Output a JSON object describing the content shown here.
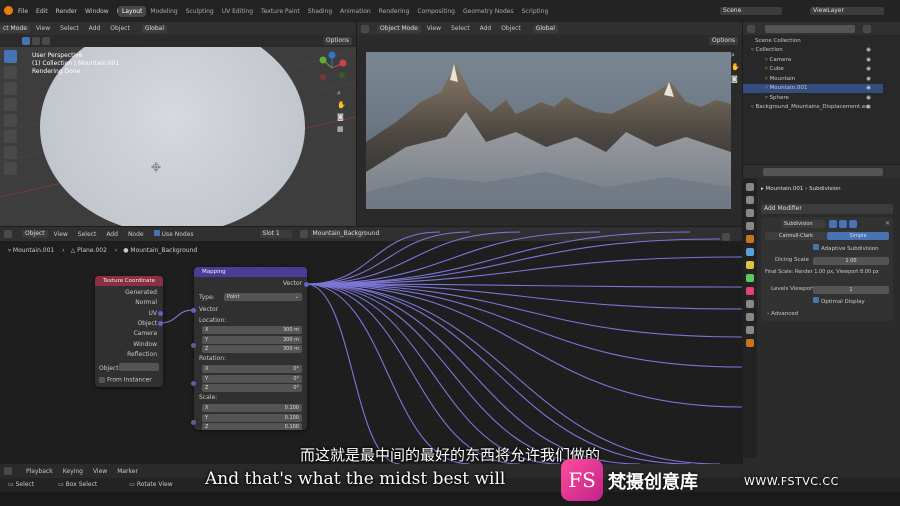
{
  "app": {
    "menus": [
      "File",
      "Edit",
      "Render",
      "Window",
      "Help"
    ],
    "workspaces": [
      "Layout",
      "Modeling",
      "Sculpting",
      "UV Editing",
      "Texture Paint",
      "Shading",
      "Animation",
      "Rendering",
      "Compositing",
      "Geometry Nodes",
      "Scripting"
    ],
    "active_workspace": "Layout",
    "scene": "Scene",
    "view_layer": "ViewLayer"
  },
  "viewport_left": {
    "mode": "ct Mode",
    "menus": [
      "View",
      "Select",
      "Add",
      "Object"
    ],
    "orientation": "Global",
    "options": "Options",
    "overlay_lines": [
      "User Perspective",
      "(1) Collection | Mountain.001",
      "Rendering Done"
    ]
  },
  "viewport_right": {
    "mode": "Object Mode",
    "menus": [
      "View",
      "Select",
      "Add",
      "Object"
    ],
    "orientation": "Global",
    "options": "Options"
  },
  "outliner": {
    "title": "Scene Collection",
    "items": [
      {
        "label": "Collection",
        "indent": 0
      },
      {
        "label": "Camera",
        "indent": 1
      },
      {
        "label": "Cube",
        "indent": 1
      },
      {
        "label": "Mountain",
        "indent": 1
      },
      {
        "label": "Mountain.001",
        "indent": 1,
        "selected": true
      },
      {
        "label": "Sphere",
        "indent": 1
      },
      {
        "label": "Background_Mountains_Displacement.ex",
        "indent": 0
      }
    ]
  },
  "properties": {
    "object": "Mountain.001",
    "modifier_tab": "Subdivision",
    "add_modifier": "Add Modifier",
    "modifier_name": "Subdivision",
    "catmull": "Catmull-Clark",
    "simple": "Simple",
    "adaptive": "Adaptive Subdivision",
    "dicing_label": "Dicing Scale",
    "dicing_value": "1.00",
    "final_scale": "Final Scale: Render 1.00 px, Viewport 8.00 px",
    "levels_label": "Levels Viewport",
    "levels_value": "1",
    "optimal": "Optimal Display",
    "advanced": "Advanced"
  },
  "node_editor": {
    "type": "Object",
    "menus": [
      "View",
      "Select",
      "Add",
      "Node"
    ],
    "use_nodes": "Use Nodes",
    "slot": "Slot 1",
    "material": "Mountain_Background",
    "breadcrumb": [
      "Mountain.001",
      "Plane.002",
      "Mountain_Background"
    ]
  },
  "tex_coord": {
    "title": "Texture Coordinate",
    "outputs": [
      "Generated",
      "Normal",
      "UV",
      "Object",
      "Camera",
      "Window",
      "Reflection"
    ],
    "object_label": "Object:",
    "from_instancer": "From Instancer"
  },
  "mapping": {
    "title": "Mapping",
    "out": "Vector",
    "type_label": "Type:",
    "type_value": "Point",
    "vector": "Vector",
    "location": "Location:",
    "loc": [
      [
        "X",
        "300 m"
      ],
      [
        "Y",
        "300 m"
      ],
      [
        "Z",
        "300 m"
      ]
    ],
    "rotation": "Rotation:",
    "rot": [
      [
        "X",
        "0°"
      ],
      [
        "Y",
        "0°"
      ],
      [
        "Z",
        "0°"
      ]
    ],
    "scale": "Scale:",
    "scl": [
      [
        "X",
        "0.100"
      ],
      [
        "Y",
        "0.100"
      ],
      [
        "Z",
        "0.100"
      ]
    ]
  },
  "timeline": {
    "menus": [
      "Playback",
      "Keying",
      "View",
      "Marker"
    ]
  },
  "status": {
    "items": [
      "Select",
      "Box Select",
      "Rotate View"
    ]
  },
  "subtitle": {
    "chinese": "而这就是最中间的最好的东西将允许我们做的",
    "english": "And that's what the midst best will"
  },
  "watermark": {
    "logo": "FS",
    "brand": "梵摄创意库",
    "url": "WWW.FSTVC.CC"
  }
}
